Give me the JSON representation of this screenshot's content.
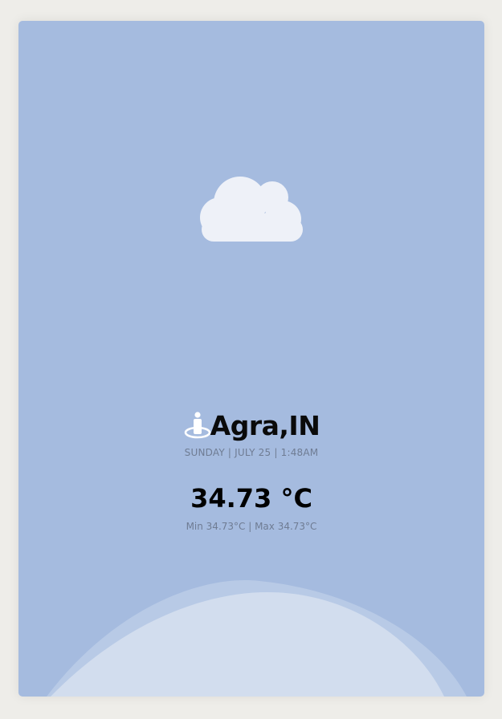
{
  "weather": {
    "condition_icon": "cloud-icon",
    "location_icon": "location-pin-icon",
    "city": "Agra,IN",
    "datetime": "SUNDAY | JULY 25 | 1:48AM",
    "temperature": "34.73 °C",
    "min_max": "Min 34.73°C | Max 34.73°C"
  },
  "colors": {
    "card_background": "#a5bbdf",
    "cloud": "#eef1f8",
    "page_background": "#eeede9"
  }
}
